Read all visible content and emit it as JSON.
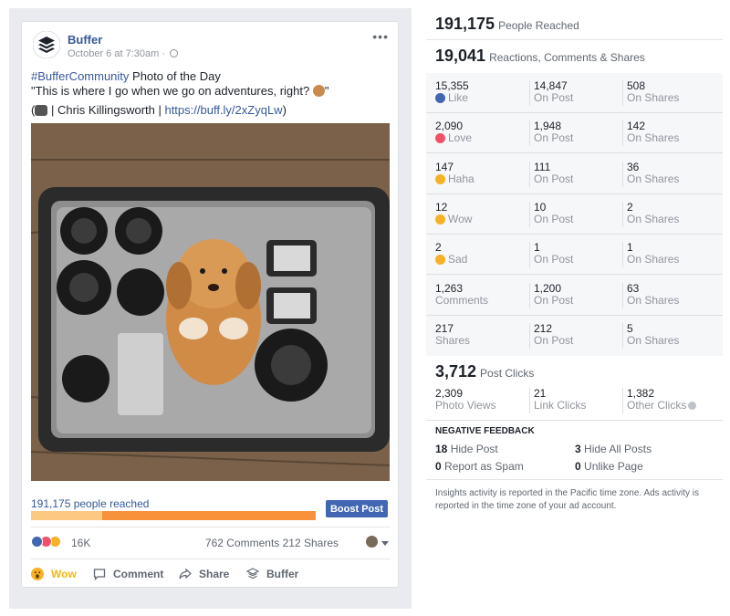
{
  "post": {
    "page_name": "Buffer",
    "meta": "October 6 at 7:30am ·",
    "text_hashtag": "#BufferCommunity",
    "text_line1_rest": " Photo of the Day",
    "text_line2": "\"This is where I go when we go on adventures, right? ",
    "text_line2_end": "\"",
    "credit_prefix": " | Chris Killingsworth | ",
    "credit_link": "https://buff.ly/2xZyqLw",
    "credit_end": ")",
    "credit_open": "(",
    "reach_label": "191,175 people reached",
    "boost_label": "Boost Post",
    "reach_organic_fraction": 0.25,
    "reaction_count": "16K",
    "comments_shares": "762 Comments  212 Shares",
    "actions": {
      "wow": "Wow",
      "comment": "Comment",
      "share": "Share",
      "buffer": "Buffer"
    }
  },
  "insights": {
    "people_reached": {
      "value": "191,175",
      "label": "People Reached"
    },
    "engagement": {
      "value": "19,041",
      "label": "Reactions, Comments & Shares"
    },
    "rows": [
      {
        "total": "15,355",
        "name": "Like",
        "on_post": "14,847",
        "on_post_label": "On Post",
        "on_shares": "508",
        "on_shares_label": "On Shares"
      },
      {
        "total": "2,090",
        "name": "Love",
        "on_post": "1,948",
        "on_post_label": "On Post",
        "on_shares": "142",
        "on_shares_label": "On Shares"
      },
      {
        "total": "147",
        "name": "Haha",
        "on_post": "111",
        "on_post_label": "On Post",
        "on_shares": "36",
        "on_shares_label": "On Shares"
      },
      {
        "total": "12",
        "name": "Wow",
        "on_post": "10",
        "on_post_label": "On Post",
        "on_shares": "2",
        "on_shares_label": "On Shares"
      },
      {
        "total": "2",
        "name": "Sad",
        "on_post": "1",
        "on_post_label": "On Post",
        "on_shares": "1",
        "on_shares_label": "On Shares"
      },
      {
        "total": "1,263",
        "name": "Comments",
        "on_post": "1,200",
        "on_post_label": "On Post",
        "on_shares": "63",
        "on_shares_label": "On Shares"
      },
      {
        "total": "217",
        "name": "Shares",
        "on_post": "212",
        "on_post_label": "On Post",
        "on_shares": "5",
        "on_shares_label": "On Shares"
      }
    ],
    "post_clicks": {
      "value": "3,712",
      "label": "Post Clicks"
    },
    "clicks": [
      {
        "value": "2,309",
        "label": "Photo Views"
      },
      {
        "value": "21",
        "label": "Link Clicks"
      },
      {
        "value": "1,382",
        "label": "Other Clicks"
      }
    ],
    "negative": {
      "title": "NEGATIVE FEEDBACK",
      "hide_post": {
        "value": "18",
        "label": "Hide Post"
      },
      "hide_all": {
        "value": "3",
        "label": "Hide All Posts"
      },
      "spam": {
        "value": "0",
        "label": "Report as Spam"
      },
      "unlike": {
        "value": "0",
        "label": "Unlike Page"
      }
    },
    "footnote": "Insights activity is reported in the Pacific time zone. Ads activity is reported in the time zone of your ad account."
  },
  "colors": {
    "fb_blue": "#4267b2",
    "link": "#365899",
    "reach_paid": "#f7923b",
    "reach_organic": "#fcc982",
    "wow_yellow": "#f0ba15"
  },
  "icons": {
    "like": "like-icon",
    "love": "love-icon",
    "haha": "haha-icon",
    "wow": "wow-icon",
    "sad": "sad-icon"
  }
}
